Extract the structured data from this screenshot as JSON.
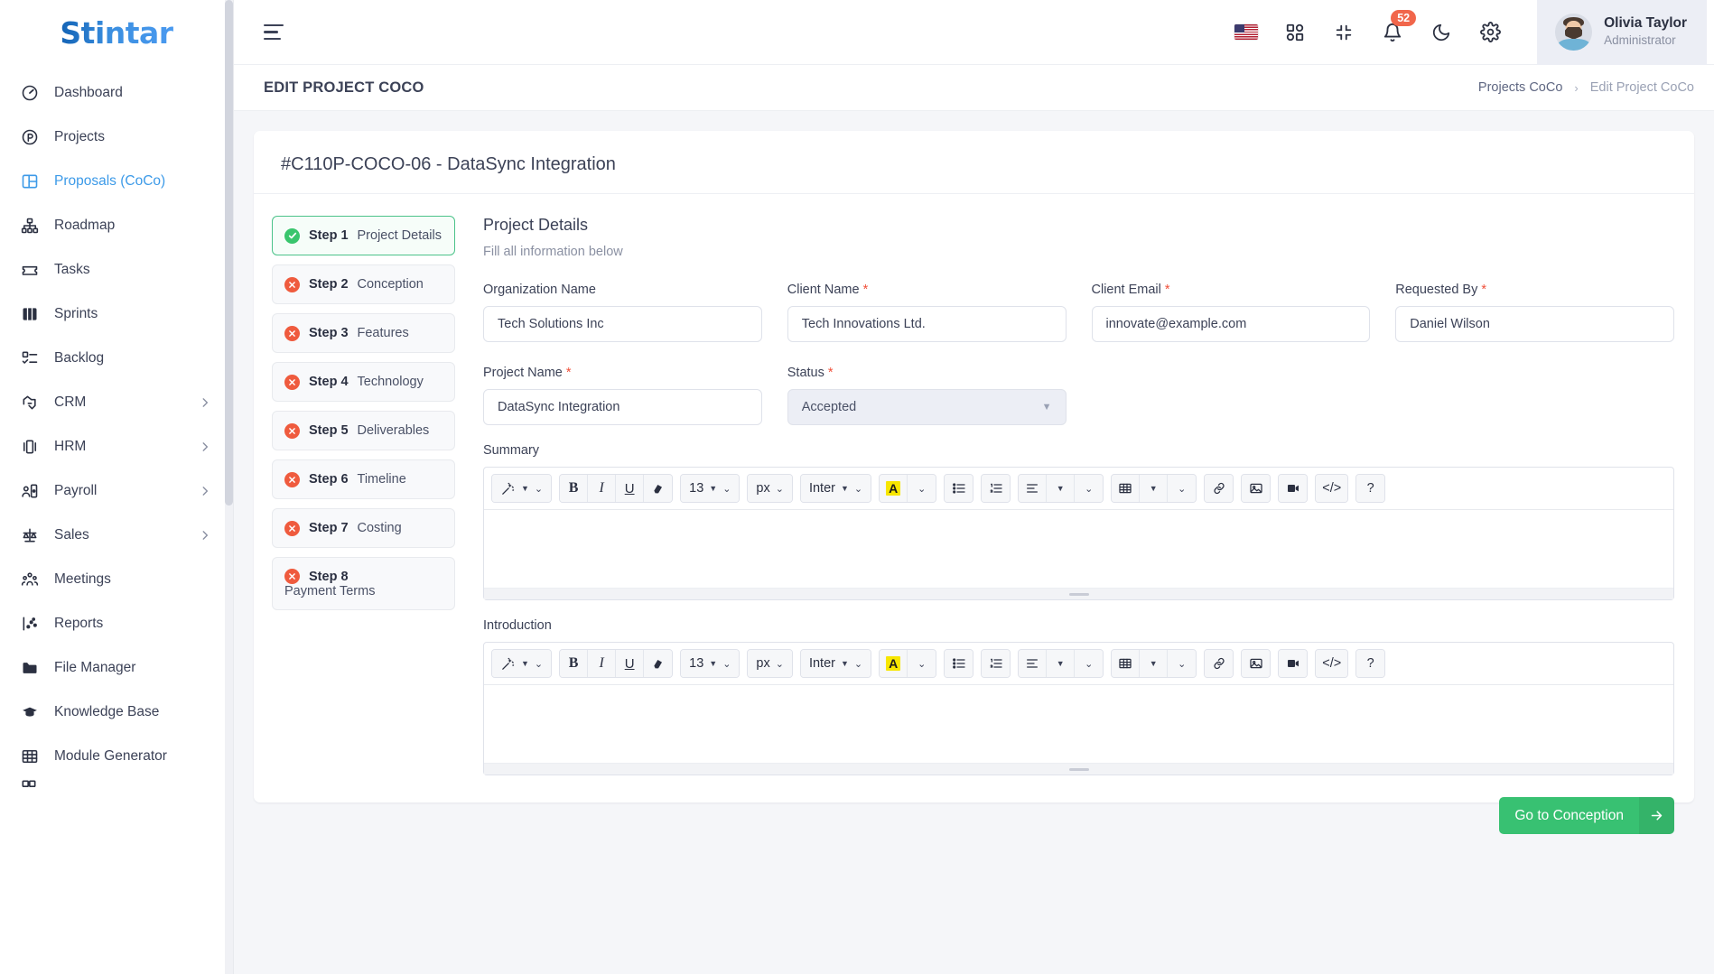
{
  "brand": {
    "name": "Stintar"
  },
  "sidebar": {
    "items": [
      {
        "label": "Dashboard",
        "icon": "gauge-icon",
        "active": false,
        "expandable": false
      },
      {
        "label": "Projects",
        "icon": "circle-p-icon",
        "active": false,
        "expandable": false
      },
      {
        "label": "Proposals (CoCo)",
        "icon": "layout-panels-icon",
        "active": true,
        "expandable": false
      },
      {
        "label": "Roadmap",
        "icon": "sitemap-icon",
        "active": false,
        "expandable": false
      },
      {
        "label": "Tasks",
        "icon": "ticket-icon",
        "active": false,
        "expandable": false
      },
      {
        "label": "Sprints",
        "icon": "board-columns-icon",
        "active": false,
        "expandable": false
      },
      {
        "label": "Backlog",
        "icon": "checklist-icon",
        "active": false,
        "expandable": false
      },
      {
        "label": "CRM",
        "icon": "handshake-icon",
        "active": false,
        "expandable": true
      },
      {
        "label": "HRM",
        "icon": "carousel-icon",
        "active": false,
        "expandable": true
      },
      {
        "label": "Payroll",
        "icon": "user-card-icon",
        "active": false,
        "expandable": true
      },
      {
        "label": "Sales",
        "icon": "scales-icon",
        "active": false,
        "expandable": true
      },
      {
        "label": "Meetings",
        "icon": "people-group-icon",
        "active": false,
        "expandable": false
      },
      {
        "label": "Reports",
        "icon": "chart-dots-icon",
        "active": false,
        "expandable": false
      },
      {
        "label": "File Manager",
        "icon": "folder-icon",
        "active": false,
        "expandable": false
      },
      {
        "label": "Knowledge Base",
        "icon": "graduation-cap-icon",
        "active": false,
        "expandable": false
      },
      {
        "label": "Module Generator",
        "icon": "grid-table-icon",
        "active": false,
        "expandable": false
      }
    ]
  },
  "topbar": {
    "menu_toggle": "hamburger-icon",
    "language_flag": "us-flag-icon",
    "apps_icon": "apps-grid-icon",
    "fullscreen_icon": "collapse-screen-icon",
    "notification_icon": "bell-icon",
    "notification_count": "52",
    "theme_icon": "moon-icon",
    "settings_icon": "gear-icon",
    "user": {
      "name": "Olivia Taylor",
      "role": "Administrator"
    }
  },
  "pagehead": {
    "title": "EDIT PROJECT COCO",
    "breadcrumb": {
      "parent": "Projects CoCo",
      "separator": "›",
      "current": "Edit Project CoCo"
    }
  },
  "card": {
    "title": "#C110P-COCO-06 - DataSync Integration",
    "steps": [
      {
        "num": "Step 1",
        "name": "Project Details",
        "state": "done"
      },
      {
        "num": "Step 2",
        "name": "Conception",
        "state": "error"
      },
      {
        "num": "Step 3",
        "name": "Features",
        "state": "error"
      },
      {
        "num": "Step 4",
        "name": "Technology",
        "state": "error"
      },
      {
        "num": "Step 5",
        "name": "Deliverables",
        "state": "error"
      },
      {
        "num": "Step 6",
        "name": "Timeline",
        "state": "error"
      },
      {
        "num": "Step 7",
        "name": "Costing",
        "state": "error"
      },
      {
        "num": "Step 8",
        "name": "Payment Terms",
        "state": "error"
      }
    ],
    "form": {
      "heading": "Project Details",
      "subheading": "Fill all information below",
      "fields": [
        {
          "label": "Organization Name",
          "required": false,
          "value": "Tech Solutions Inc",
          "type": "text"
        },
        {
          "label": "Client Name",
          "required": true,
          "value": "Tech Innovations Ltd.",
          "type": "text"
        },
        {
          "label": "Client Email",
          "required": true,
          "value": "innovate@example.com",
          "type": "text"
        },
        {
          "label": "Requested By",
          "required": true,
          "value": "Daniel Wilson",
          "type": "text"
        },
        {
          "label": "Project Name",
          "required": true,
          "value": "DataSync Integration",
          "type": "text"
        },
        {
          "label": "Status",
          "required": true,
          "value": "Accepted",
          "type": "select"
        }
      ],
      "editors": [
        {
          "label": "Summary",
          "content": ""
        },
        {
          "label": "Introduction",
          "content": ""
        }
      ],
      "toolbar": {
        "magic": "magic-wand-icon",
        "bold": "B",
        "italic": "I",
        "underline": "U",
        "eraser": "eraser-icon",
        "font_size": "13",
        "size_unit": "px",
        "font_family": "Inter",
        "highlight": "A",
        "bullet_list": "bullet-list-icon",
        "number_list": "numbered-list-icon",
        "align": "align-left-icon",
        "table": "table-icon",
        "link": "link-icon",
        "image": "image-icon",
        "video": "video-icon",
        "code": "</>",
        "help": "?"
      },
      "submit_label": "Go to Conception",
      "submit_arrow": "arrow-right-icon"
    }
  },
  "colors": {
    "accent": "#3c9ae8",
    "success": "#38c172",
    "danger": "#ef5b3e",
    "required": "#f0503a",
    "badge": "#f1664b"
  }
}
